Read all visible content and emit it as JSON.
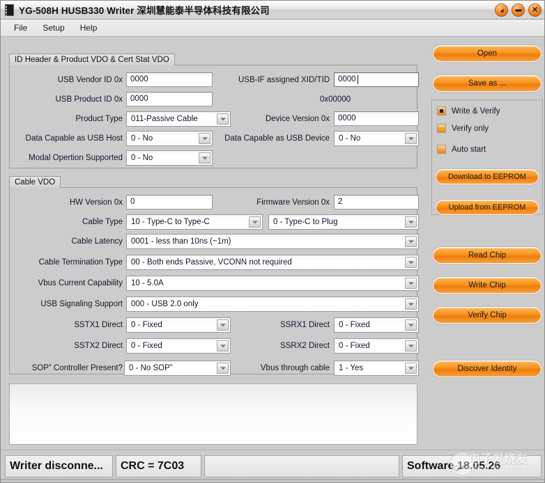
{
  "window": {
    "title": "YG-508H HUSB330 Writer  深圳慧能泰半导体科技有限公司",
    "icon": "chip-icon",
    "controls": {
      "restore": "restore",
      "minimize": "minimize",
      "close": "close"
    }
  },
  "menubar": {
    "items": [
      "File",
      "Setup",
      "Help"
    ]
  },
  "id_header_group": {
    "legend": "ID Header & Product VDO & Cert Stat VDO",
    "fields": [
      {
        "label": "USB Vendor ID 0x",
        "value": "0000",
        "type": "text"
      },
      {
        "label": "USB-IF assigned XID/TID",
        "value": "0000",
        "type": "text"
      },
      {
        "label": "USB Product ID 0x",
        "value": "0000",
        "type": "text"
      },
      {
        "label": "",
        "value": "0x00000",
        "type": "static"
      },
      {
        "label": "Product Type",
        "value": "011-Passive Cable",
        "type": "combo"
      },
      {
        "label": "Device Version 0x",
        "value": "0000",
        "type": "text"
      },
      {
        "label": "Data Capable as USB Host",
        "value": "0 - No",
        "type": "combo"
      },
      {
        "label": "Data Capable as USB Device",
        "value": "0 - No",
        "type": "combo"
      },
      {
        "label": "Modal Opertion Supported",
        "value": "0 - No",
        "type": "combo"
      }
    ]
  },
  "cable_vdo_group": {
    "legend": "Cable VDO",
    "fields": [
      {
        "label": "HW Version  0x",
        "value": "0",
        "type": "text"
      },
      {
        "label": "Firmware Version  0x",
        "value": "2",
        "type": "text"
      },
      {
        "label": "Cable Type",
        "value": "10 - Type-C to Type-C",
        "type": "combo"
      },
      {
        "label": "",
        "value": "0 - Type-C to Plug",
        "type": "combo"
      },
      {
        "label": "Cable Latency",
        "value": "0001 - less than 10ns (~1m)",
        "type": "combo"
      },
      {
        "label": "Cable Termination Type",
        "value": "00 - Both ends Passive, VCONN not required",
        "type": "combo"
      },
      {
        "label": "Vbus Current Capability",
        "value": "10 - 5.0A",
        "type": "combo"
      },
      {
        "label": "USB Signaling Support",
        "value": "000 - USB 2.0 only",
        "type": "combo"
      },
      {
        "label": "SSTX1 Direct",
        "value": "0 - Fixed",
        "type": "combo"
      },
      {
        "label": "SSRX1 Direct",
        "value": "0 - Fixed",
        "type": "combo"
      },
      {
        "label": "SSTX2 Direct",
        "value": "0 - Fixed",
        "type": "combo"
      },
      {
        "label": "SSRX2 Direct",
        "value": "0 - Fixed",
        "type": "combo"
      },
      {
        "label": "SOP” Controller Present?",
        "value": "0 - No SOP”",
        "type": "combo"
      },
      {
        "label": "Vbus through cable",
        "value": "1 - Yes",
        "type": "combo"
      }
    ]
  },
  "log_area": {
    "text": ""
  },
  "right_panel": {
    "open_button": "Open",
    "save_as_button": "Save as ...",
    "options": [
      {
        "label": "Write & Verify",
        "checked": true
      },
      {
        "label": "Verify only",
        "checked": false
      },
      {
        "label": "Auto start",
        "checked": false
      }
    ],
    "download_button": "Download to EEPROM",
    "upload_button": "Upload from EEPROM",
    "read_chip_button": "Read Chip",
    "write_chip_button": "Write Chip",
    "verify_chip_button": "Verify Chip",
    "discover_identity_button": "Discover Identity"
  },
  "statusbar": {
    "connection": "Writer disconne...",
    "crc": "CRC = 7C03",
    "message": "",
    "software": "Software 18.05.26"
  },
  "watermark": {
    "cn": "电子发烧友",
    "url": "www.elecfans.com"
  },
  "colors": {
    "accent_orange": "#f8941d",
    "window_bg": "#cccccc",
    "label_text": "#14142b"
  }
}
